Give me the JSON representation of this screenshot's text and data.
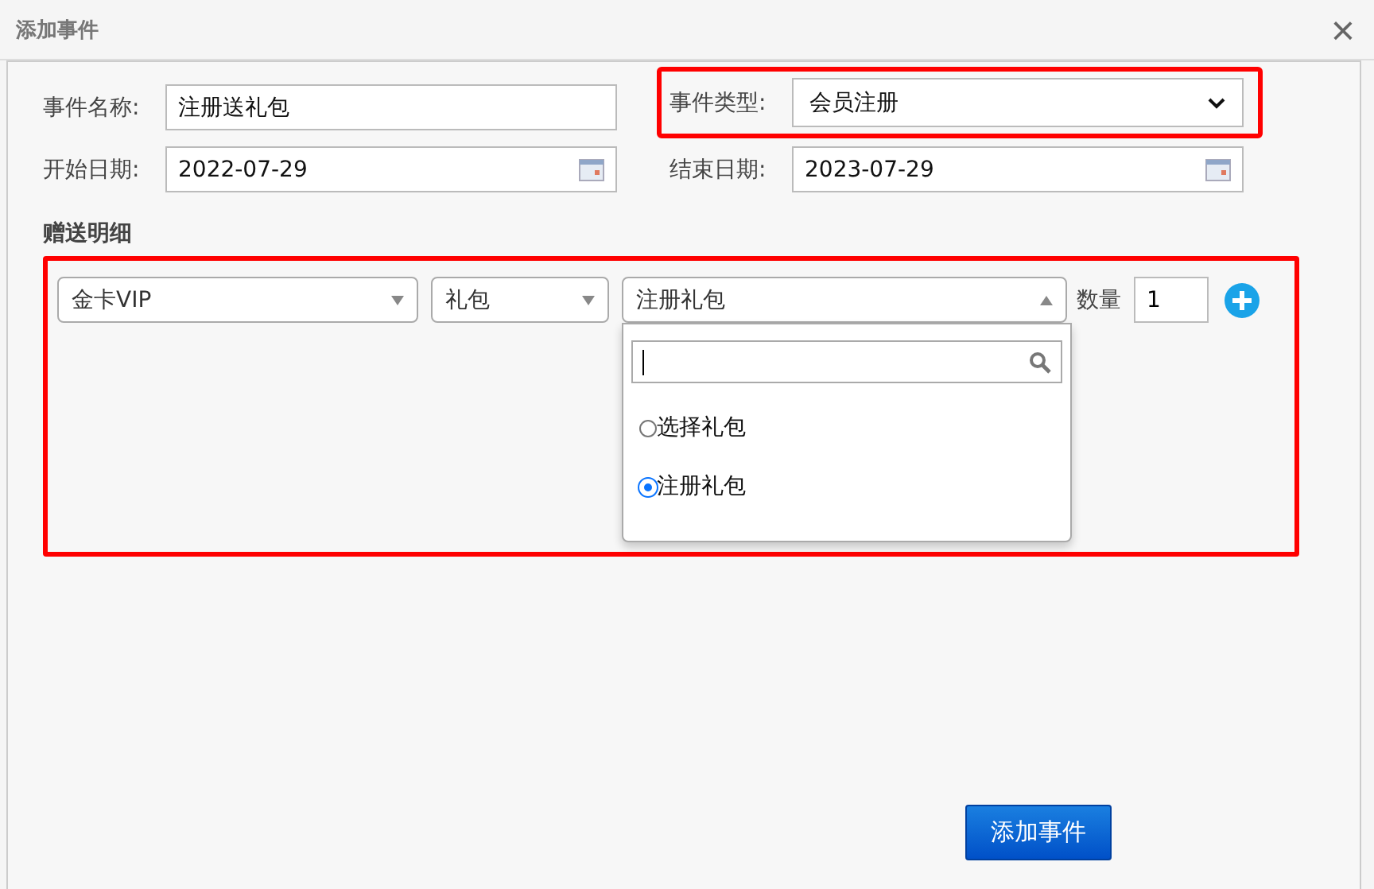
{
  "window": {
    "title": "添加事件",
    "close": "×"
  },
  "form": {
    "name_label": "事件名称:",
    "name_value": "注册送礼包",
    "type_label": "事件类型:",
    "type_value": "会员注册",
    "start_label": "开始日期:",
    "start_value": "2022-07-29",
    "end_label": "结束日期:",
    "end_value": "2023-07-29"
  },
  "gift": {
    "heading": "赠送明细",
    "member_select": "金卡VIP",
    "kind_select": "礼包",
    "package_select": "注册礼包",
    "quantity_label": "数量",
    "quantity_value": "1",
    "dropdown": {
      "expanded": true,
      "options": [
        {
          "label": "选择礼包",
          "selected": false
        },
        {
          "label": "注册礼包",
          "selected": true
        }
      ]
    }
  },
  "submit": "添加事件"
}
